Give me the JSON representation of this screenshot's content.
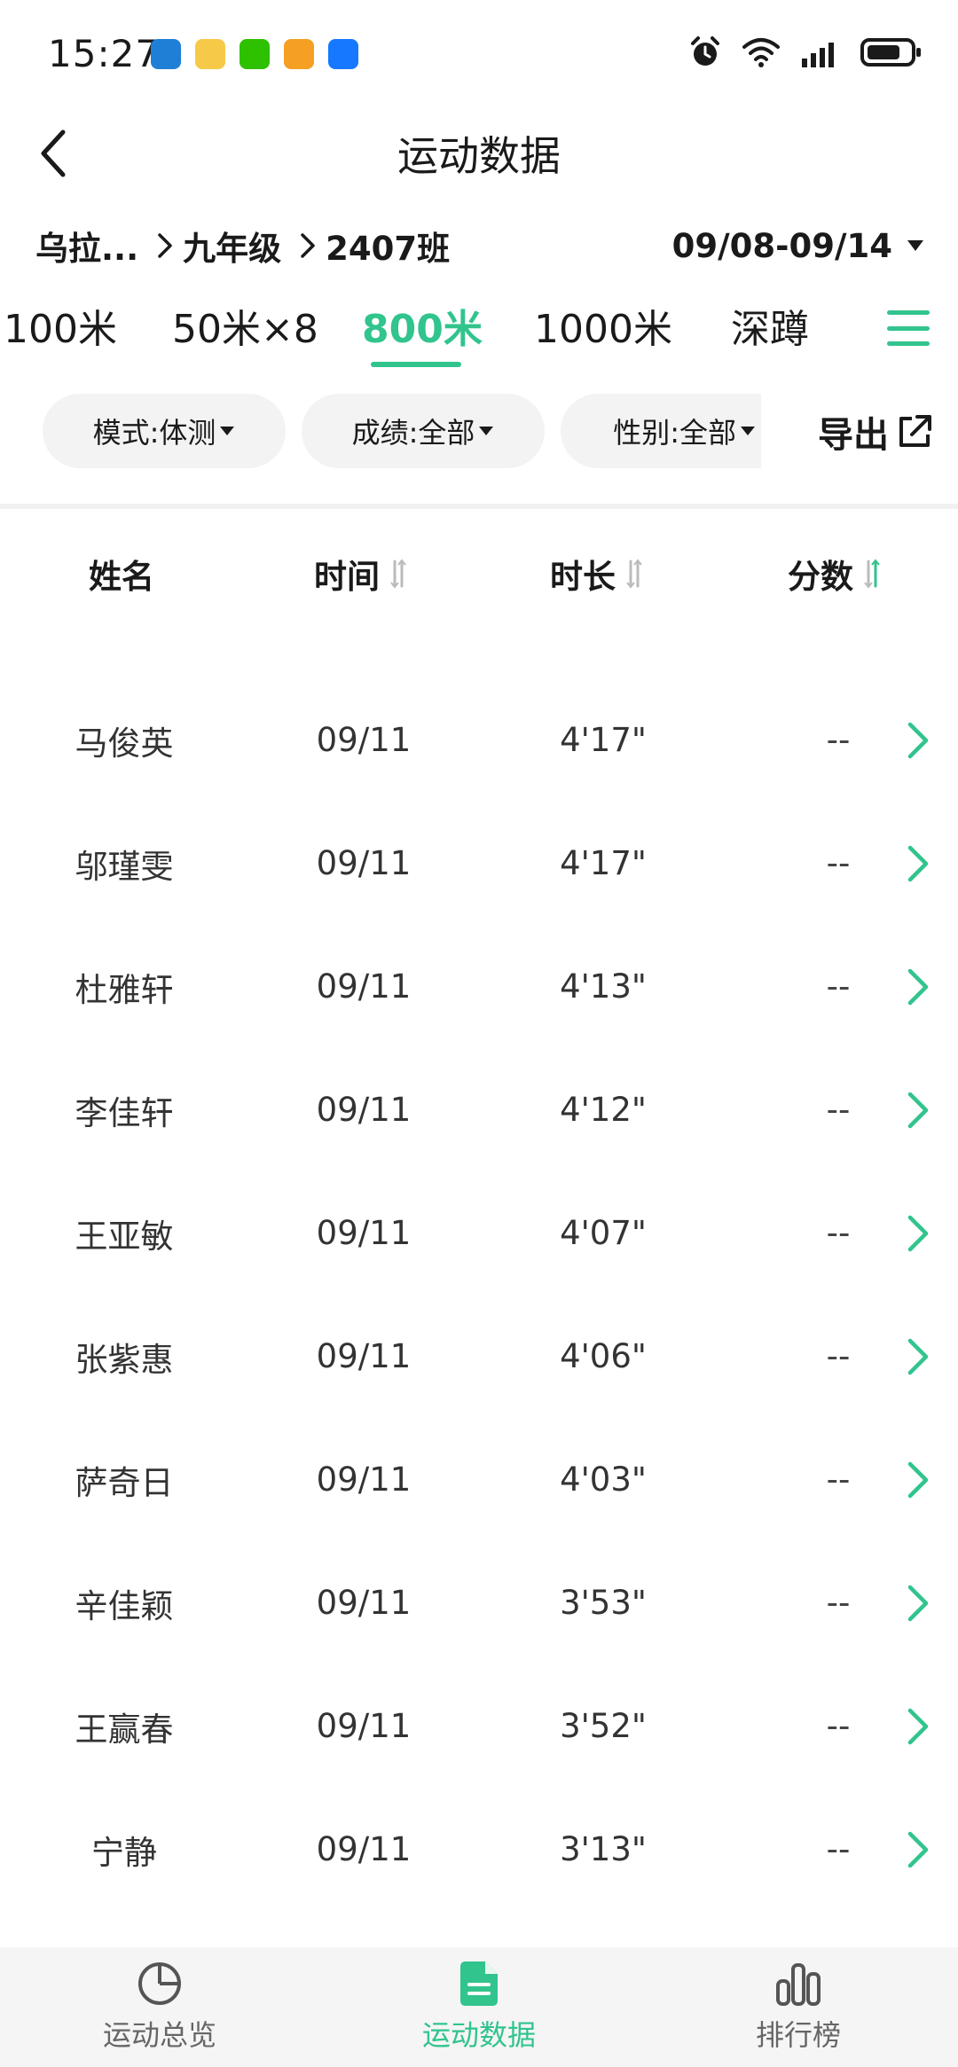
{
  "status_bar": {
    "time": "15:27"
  },
  "header": {
    "title": "运动数据"
  },
  "breadcrumb": {
    "school": "乌拉...",
    "grade": "九年级",
    "class": "2407班"
  },
  "date_range": "09/08-09/14",
  "event_tabs": [
    "100米",
    "50米×8",
    "800米",
    "1000米",
    "深蹲"
  ],
  "active_event_tab": "800米",
  "filters": {
    "mode": "模式:体测",
    "grade": "成绩:全部",
    "gender": "性别:全部"
  },
  "export_label": "导出",
  "table": {
    "columns": [
      "姓名",
      "时间",
      "时长",
      "分数"
    ],
    "rows": [
      {
        "name": "马俊英",
        "date": "09/11",
        "duration": "4'17\"",
        "score": "--"
      },
      {
        "name": "邬瑾雯",
        "date": "09/11",
        "duration": "4'17\"",
        "score": "--"
      },
      {
        "name": "杜雅轩",
        "date": "09/11",
        "duration": "4'13\"",
        "score": "--"
      },
      {
        "name": "李佳轩",
        "date": "09/11",
        "duration": "4'12\"",
        "score": "--"
      },
      {
        "name": "王亚敏",
        "date": "09/11",
        "duration": "4'07\"",
        "score": "--"
      },
      {
        "name": "张紫惠",
        "date": "09/11",
        "duration": "4'06\"",
        "score": "--"
      },
      {
        "name": "萨奇日",
        "date": "09/11",
        "duration": "4'03\"",
        "score": "--"
      },
      {
        "name": "辛佳颖",
        "date": "09/11",
        "duration": "3'53\"",
        "score": "--"
      },
      {
        "name": "王赢春",
        "date": "09/11",
        "duration": "3'52\"",
        "score": "--"
      },
      {
        "name": "宁静",
        "date": "09/11",
        "duration": "3'13\"",
        "score": "--"
      }
    ]
  },
  "bottom_nav": {
    "items": [
      "运动总览",
      "运动数据",
      "排行榜"
    ],
    "active": "运动数据"
  },
  "colors": {
    "accent": "#31c48d",
    "text": "#1a1a1a",
    "pill_bg": "#f3f3f3",
    "nav_bg": "#f5f5f5"
  },
  "icons": {
    "back": "chevron-left-icon",
    "dropdown": "caret-down-icon",
    "menu": "hamburger-icon",
    "export": "external-link-icon",
    "sort": "sort-icon",
    "row_arrow": "chevron-right-icon",
    "nav_overview": "pie-chart-icon",
    "nav_data": "document-icon",
    "nav_rank": "bar-chart-icon"
  }
}
